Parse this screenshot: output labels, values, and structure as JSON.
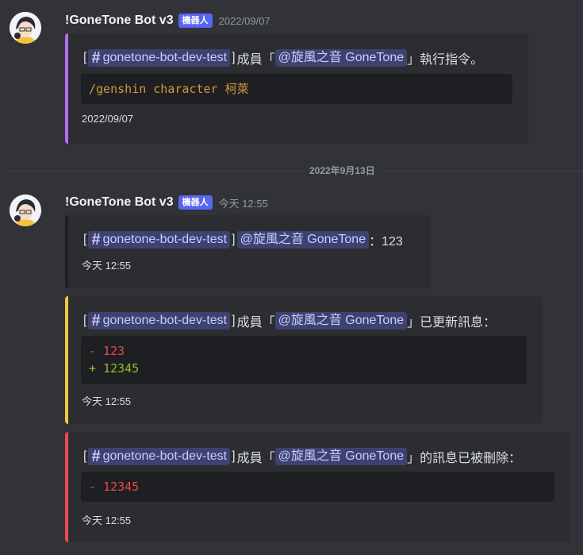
{
  "messages": [
    {
      "username": "!GoneTone Bot v3",
      "badge": "機器人",
      "timestamp": "2022/09/07",
      "embeds": [
        {
          "color": "#b56cf2",
          "channel": "gonetone-bot-dev-test",
          "pre": "成員「",
          "mention": "@旋風之音 GoneTone",
          "post": "」執行指令。",
          "code": [
            "/genshin character 柯萊"
          ],
          "footer": "2022/09/07"
        }
      ]
    },
    {
      "username": "!GoneTone Bot v3",
      "badge": "機器人",
      "timestamp": "今天 12:55",
      "embeds": [
        {
          "color": "#1e1f22",
          "channel": "gonetone-bot-dev-test",
          "mention": "@旋風之音 GoneTone",
          "post": "：123",
          "footer": "今天 12:55"
        },
        {
          "color": "#f0c93d",
          "channel": "gonetone-bot-dev-test",
          "pre": "成員「",
          "mention": "@旋風之音 GoneTone",
          "post": "」已更新訊息：",
          "code": [
            "- 123",
            "+ 12345"
          ],
          "footer": "今天 12:55"
        },
        {
          "color": "#f0475b",
          "channel": "gonetone-bot-dev-test",
          "pre": "成員「",
          "mention": "@旋風之音 GoneTone",
          "post": "」的訊息已被刪除：",
          "code": [
            "- 12345"
          ],
          "footer": "今天 12:55"
        }
      ]
    }
  ],
  "divider": "2022年9月13日",
  "colors": {
    "code_command": "#d19a3a",
    "diff_removed": "#e5484d",
    "diff_added": "#8fbf2a",
    "bot_badge": "#5865f2"
  }
}
